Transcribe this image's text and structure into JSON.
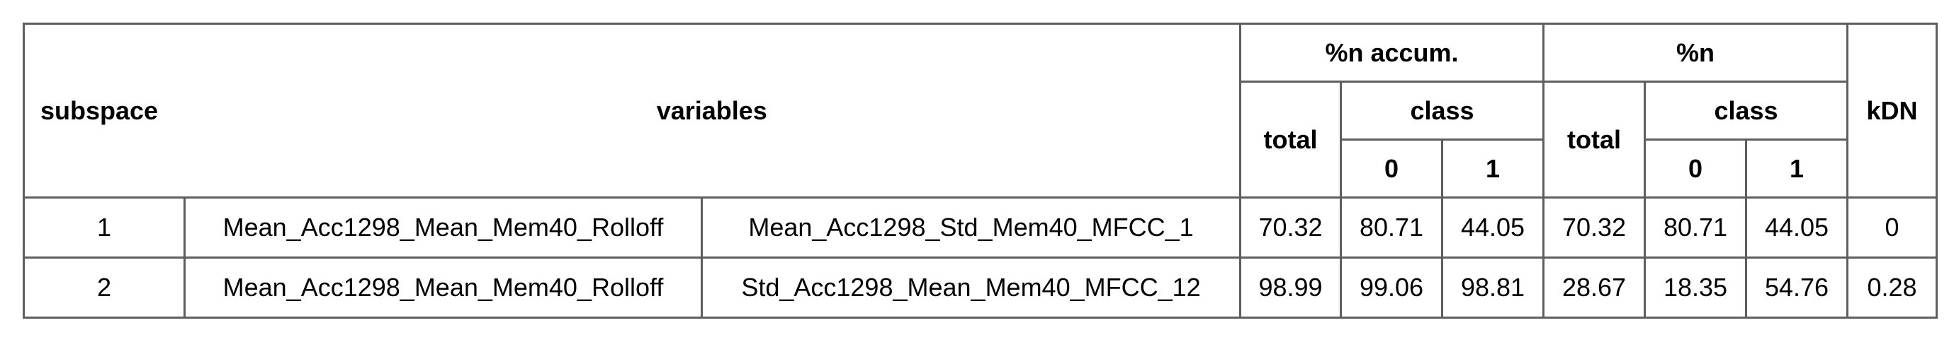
{
  "table": {
    "headers": {
      "subspace": "subspace",
      "variables": "variables",
      "accum_group": "%n accum.",
      "n_group": "%n",
      "kdn": "kDN",
      "total": "total",
      "class": "class",
      "class_0": "0",
      "class_1": "1"
    },
    "rows": [
      {
        "subspace": "1",
        "var1": "Mean_Acc1298_Mean_Mem40_Rolloff",
        "var2": "Mean_Acc1298_Std_Mem40_MFCC_1",
        "accum_total": "70.32",
        "accum_0": "80.71",
        "accum_1": "44.05",
        "n_total": "70.32",
        "n_0": "80.71",
        "n_1": "44.05",
        "kdn": "0"
      },
      {
        "subspace": "2",
        "var1": "Mean_Acc1298_Mean_Mem40_Rolloff",
        "var2": "Std_Acc1298_Mean_Mem40_MFCC_12",
        "accum_total": "98.99",
        "accum_0": "99.06",
        "accum_1": "98.81",
        "n_total": "28.67",
        "n_0": "18.35",
        "n_1": "54.76",
        "kdn": "0.28"
      }
    ]
  }
}
